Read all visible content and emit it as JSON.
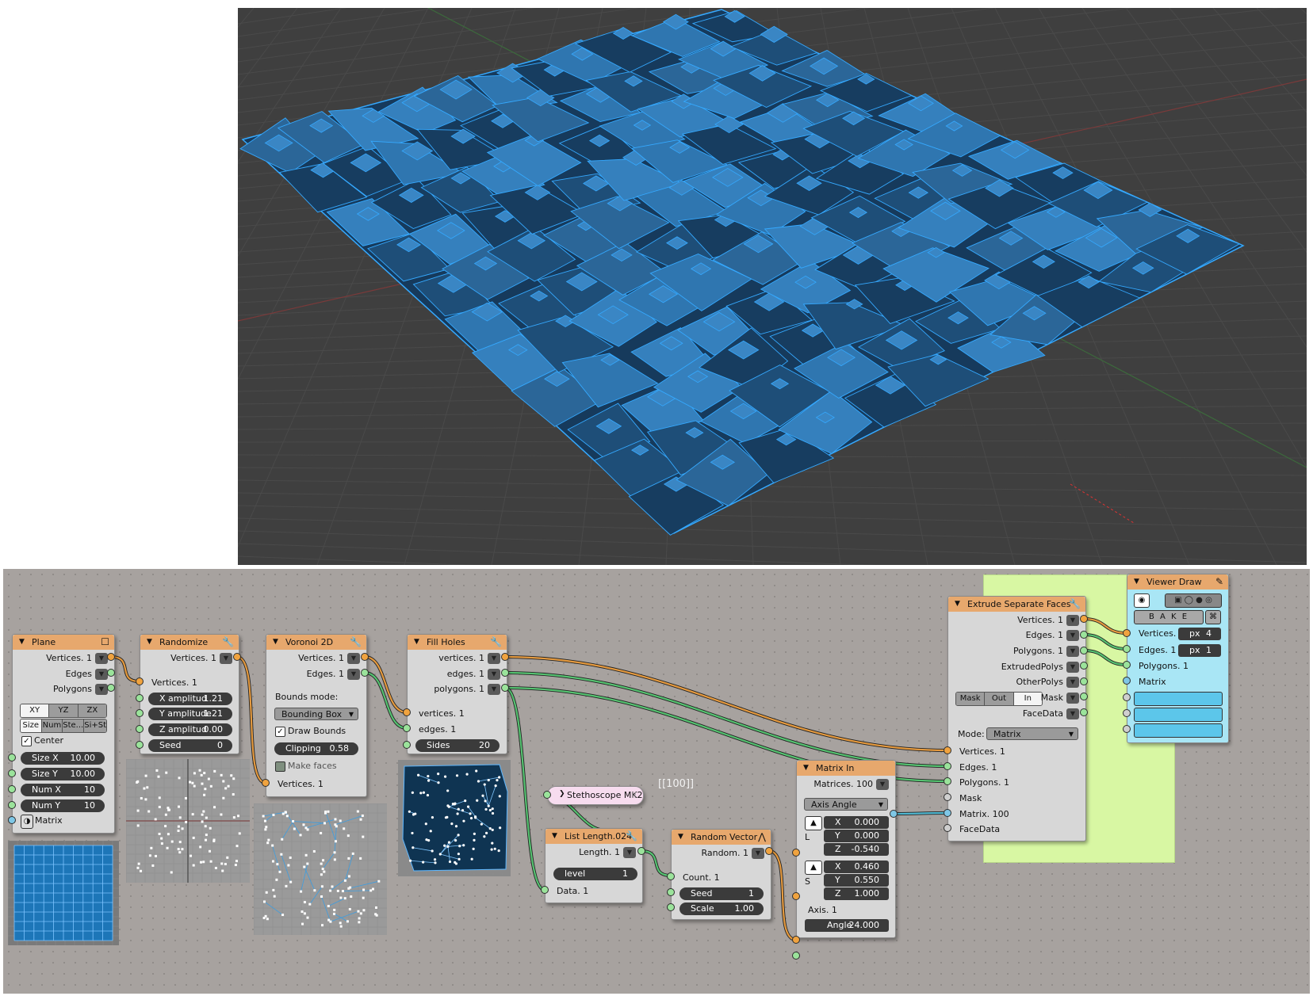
{
  "colors": {
    "mesh": "#2f76b0",
    "mesh_edge": "#35a9ff",
    "orange_wire": "#e59a3f",
    "green_wire": "#56c271",
    "teal_wire": "#4fb7d0",
    "frame": "#d8f7a3"
  },
  "nodes": {
    "plane": {
      "title": "Plane",
      "outputs": [
        "Vertices. 1",
        "Edges",
        "Polygons"
      ],
      "dims": [
        "XY",
        "YZ",
        "ZX"
      ],
      "modes": [
        "Size",
        "Num",
        "Ste...",
        "Si+St"
      ],
      "center_label": "Center",
      "fields": [
        {
          "label": "Size X",
          "value": "10.00"
        },
        {
          "label": "Size Y",
          "value": "10.00"
        },
        {
          "label": "Num X",
          "value": "10"
        },
        {
          "label": "Num Y",
          "value": "10"
        }
      ],
      "matrix_label": "Matrix"
    },
    "randomize": {
      "title": "Randomize",
      "output": "Vertices. 1",
      "input": "Vertices. 1",
      "fields": [
        {
          "label": "X amplitud",
          "value": "1.21"
        },
        {
          "label": "Y amplitude",
          "value": "1.21"
        },
        {
          "label": "Z amplitud",
          "value": "0.00"
        },
        {
          "label": "Seed",
          "value": "0"
        }
      ]
    },
    "voronoi": {
      "title": "Voronoi 2D",
      "outputs": [
        "Vertices. 1",
        "Edges. 1"
      ],
      "bounds_label": "Bounds mode:",
      "bounds_value": "Bounding Box",
      "draw_bounds": "Draw Bounds",
      "clipping_label": "Clipping",
      "clipping_value": "0.58",
      "make_faces": "Make faces",
      "input": "Vertices. 1"
    },
    "fill_holes": {
      "title": "Fill Holes",
      "outputs": [
        "vertices. 1",
        "edges. 1",
        "polygons. 1"
      ],
      "inputs": [
        "vertices. 1",
        "edges. 1"
      ],
      "sides_label": "Sides",
      "sides_value": "20"
    },
    "stethoscope": {
      "title": "Stethoscope MK2",
      "readout": "[[100]]"
    },
    "list_length": {
      "title": "List Length.024",
      "output": "Length. 1",
      "level_label": "level",
      "level_value": "1",
      "input": "Data. 1"
    },
    "random_vector": {
      "title": "Random Vector",
      "output": "Random. 1",
      "input": "Count. 1",
      "seed_label": "Seed",
      "seed_value": "1",
      "scale_label": "Scale",
      "scale_value": "1.00"
    },
    "matrix_in": {
      "title": "Matrix In",
      "output": "Matrices. 100",
      "mode": "Axis Angle",
      "l_label": "L",
      "s_label": "S",
      "location": [
        {
          "label": "X",
          "value": "0.000"
        },
        {
          "label": "Y",
          "value": "0.000"
        },
        {
          "label": "Z",
          "value": "-0.540"
        }
      ],
      "scale": [
        {
          "label": "X",
          "value": "0.460"
        },
        {
          "label": "Y",
          "value": "0.550"
        },
        {
          "label": "Z",
          "value": "1.000"
        }
      ],
      "axis_label": "Axis. 1",
      "angle_label": "Angle",
      "angle_value": "24.000"
    },
    "extrude": {
      "title": "Extrude Separate Faces",
      "outputs": [
        "Vertices. 1",
        "Edges. 1",
        "Polygons. 1",
        "ExtrudedPolys",
        "OtherPolys"
      ],
      "mask_modes": [
        "Mask",
        "Out",
        "In"
      ],
      "mask_label": "Mask",
      "facedata_label": "FaceData",
      "mode_label": "Mode:",
      "mode_value": "Matrix",
      "inputs": [
        "Vertices. 1",
        "Edges. 1",
        "Polygons. 1",
        "Mask",
        "Matrix. 100",
        "FaceData"
      ]
    },
    "viewer_draw": {
      "title": "Viewer Draw",
      "bake": "B A K E",
      "inputs": [
        "Vertices. 1",
        "Edges. 1",
        "Polygons. 1",
        "Matrix"
      ],
      "px_vertices": {
        "unit": "px",
        "value": "4"
      },
      "px_edges": {
        "unit": "px",
        "value": "1"
      }
    }
  }
}
